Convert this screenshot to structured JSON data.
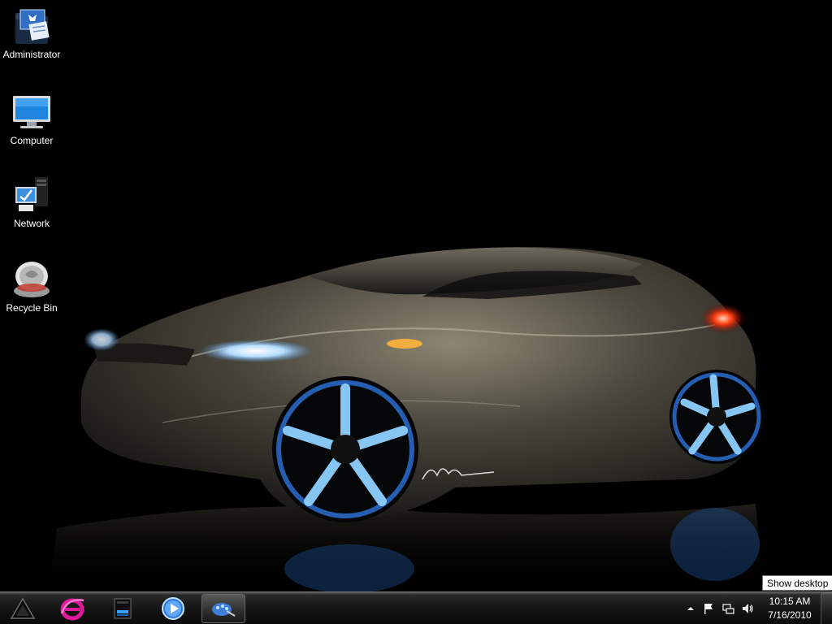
{
  "desktop": {
    "icons": [
      {
        "label": "Administrator",
        "icon": "user-folder-icon"
      },
      {
        "label": "Computer",
        "icon": "computer-monitor-icon"
      },
      {
        "label": "Network",
        "icon": "network-icon"
      },
      {
        "label": "Recycle Bin",
        "icon": "recycle-bin-icon"
      }
    ],
    "wallpaper": "concept-car-icon"
  },
  "tooltip": {
    "text": "Show desktop"
  },
  "taskbar": {
    "pinned": [
      {
        "icon": "start-logo-icon"
      },
      {
        "icon": "internet-explorer-icon"
      },
      {
        "icon": "file-explorer-icon"
      },
      {
        "icon": "media-player-icon"
      },
      {
        "icon": "paint-icon",
        "active": true
      }
    ],
    "tray": [
      {
        "icon": "show-hidden-icons-chevron"
      },
      {
        "icon": "action-center-flag-icon"
      },
      {
        "icon": "network-tray-icon"
      },
      {
        "icon": "volume-icon"
      }
    ],
    "clock": {
      "time": "10:15 AM",
      "date": "7/16/2010"
    }
  },
  "colors": {
    "accent_blue": "#4fb0ff",
    "taskbar": "#141414",
    "ie_magenta": "#e0189a"
  }
}
